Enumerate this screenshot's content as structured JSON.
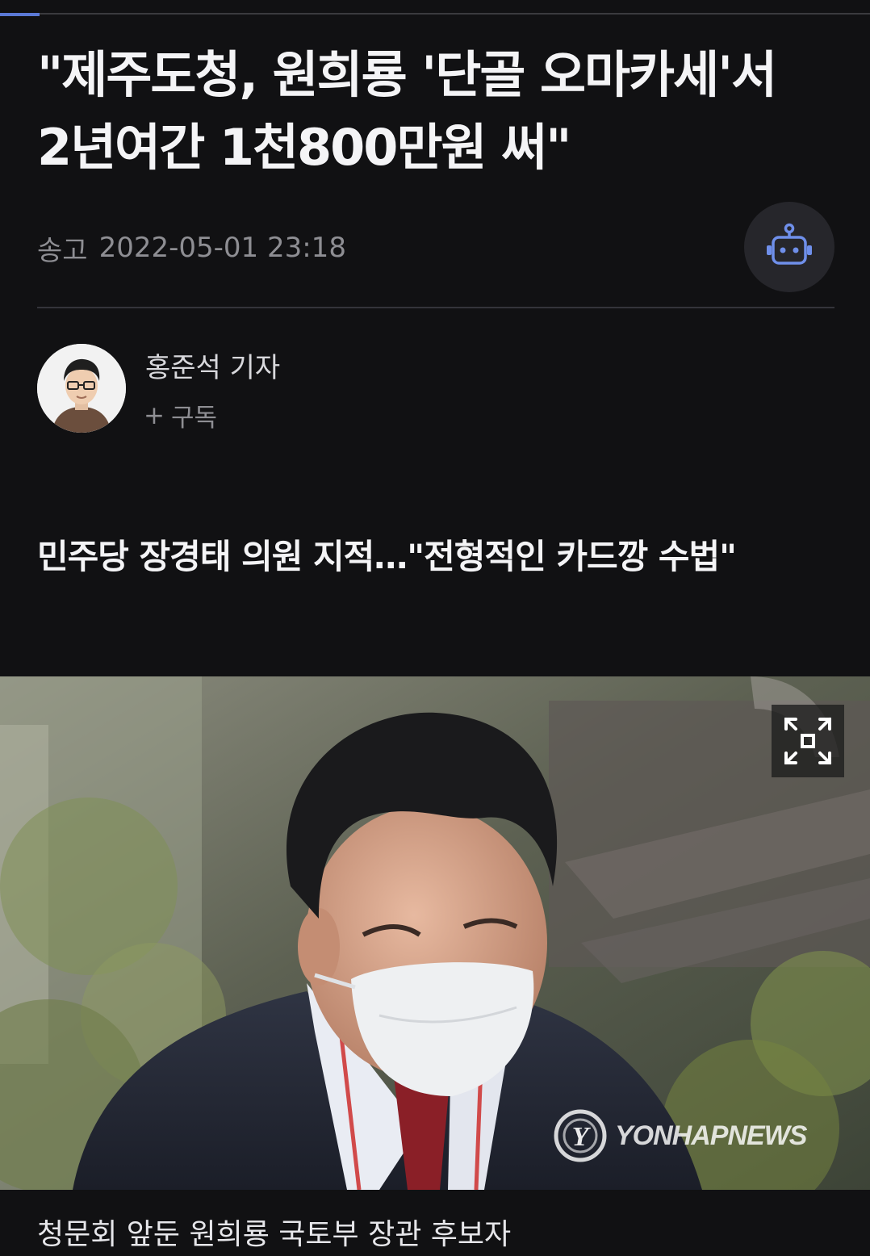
{
  "progress": {
    "fraction": 0.045,
    "color": "#5b79d6"
  },
  "article": {
    "headline_line1": "\"제주도청, 원희룡 '단골 오마카세'서",
    "headline_line2": "2년여간 1천800만원 써\"",
    "meta_label": "송고",
    "published_at": "2022-05-01 23:18",
    "subheadline": "민주당 장경태 의원 지적…\"전형적인 카드깡 수법\""
  },
  "reporter": {
    "name": "홍준석 기자",
    "subscribe_plus": "+",
    "subscribe_label": "구독"
  },
  "photo": {
    "watermark_text": "YONHAPNEWS",
    "watermark_logo_letter": "Y",
    "caption": "청문회 앞둔 원희룡 국토부 장관 후보자"
  },
  "icons": {
    "robot": "robot-icon",
    "expand": "expand-icon",
    "logo": "yonhap-logo-icon"
  },
  "colors": {
    "background": "#111113",
    "accent": "#5b79d6",
    "muted_text": "#8e8e93"
  }
}
